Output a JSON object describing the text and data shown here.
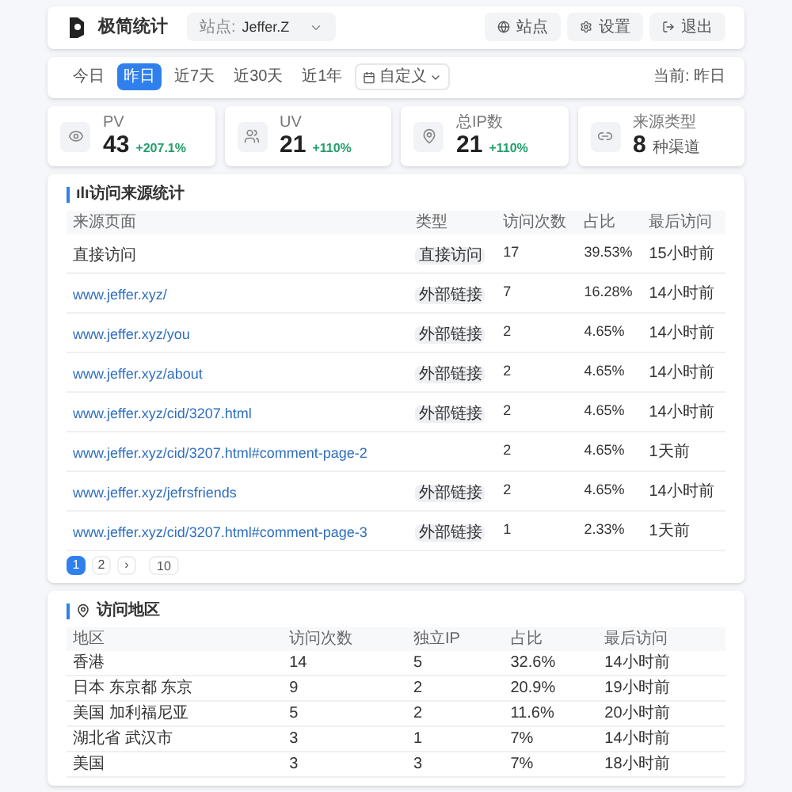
{
  "header": {
    "title": "极简统计",
    "site_label": "站点:",
    "site_value": "Jeffer.Z",
    "buttons": [
      {
        "kind": "site",
        "label": "站点"
      },
      {
        "kind": "settings",
        "label": "设置"
      },
      {
        "kind": "logout",
        "label": "退出"
      }
    ]
  },
  "filters": {
    "ranges": [
      {
        "label": "今日",
        "selected": false
      },
      {
        "label": "昨日",
        "selected": true
      },
      {
        "label": "近7天",
        "selected": false
      },
      {
        "label": "近30天",
        "selected": false
      },
      {
        "label": "近1年",
        "selected": false
      }
    ],
    "custom": "自定义",
    "current": "当前: 昨日"
  },
  "stats": [
    {
      "kind": "eye",
      "label": "PV",
      "value": "43",
      "change": "+207.1%"
    },
    {
      "kind": "users",
      "label": "UV",
      "value": "21",
      "change": "+110%"
    },
    {
      "kind": "pin",
      "label": "总IP数",
      "value": "21",
      "change": "+110%"
    },
    {
      "kind": "link",
      "label": "来源类型",
      "value": "8",
      "unit": "种渠道"
    }
  ],
  "sources": {
    "title": "访问来源统计",
    "title_icon": "ılı",
    "columns": [
      "来源页面",
      "类型",
      "访问次数",
      "占比",
      "最后访问"
    ],
    "rows": [
      {
        "page": "直接访问",
        "link": false,
        "type": "直接访问",
        "visits": "17",
        "share": "39.53%",
        "last": "15小时前"
      },
      {
        "page": "www.jeffer.xyz/",
        "link": true,
        "type": "外部链接",
        "visits": "7",
        "share": "16.28%",
        "last": "14小时前"
      },
      {
        "page": "www.jeffer.xyz/you",
        "link": true,
        "type": "外部链接",
        "visits": "2",
        "share": "4.65%",
        "last": "14小时前"
      },
      {
        "page": "www.jeffer.xyz/about",
        "link": true,
        "type": "外部链接",
        "visits": "2",
        "share": "4.65%",
        "last": "14小时前"
      },
      {
        "page": "www.jeffer.xyz/cid/3207.html",
        "link": true,
        "type": "外部链接",
        "visits": "2",
        "share": "4.65%",
        "last": "14小时前"
      },
      {
        "page": "www.jeffer.xyz/cid/3207.html#comment-page-2",
        "link": true,
        "visits": "2",
        "share": "4.65%",
        "last": "1天前"
      },
      {
        "page": "www.jeffer.xyz/jefrsfriends",
        "link": true,
        "type": "外部链接",
        "visits": "2",
        "share": "4.65%",
        "last": "14小时前"
      },
      {
        "page": "www.jeffer.xyz/cid/3207.html#comment-page-3",
        "link": true,
        "type": "外部链接",
        "visits": "1",
        "share": "2.33%",
        "last": "1天前"
      }
    ],
    "pages": [
      {
        "label": "1",
        "selected": true
      },
      {
        "label": "2",
        "selected": false
      },
      {
        "label": "›",
        "selected": false
      }
    ],
    "page_size": "10"
  },
  "regions": {
    "title": "访问地区",
    "columns": [
      "地区",
      "访问次数",
      "独立IP",
      "占比",
      "最后访问"
    ],
    "rows": [
      [
        "香港",
        "14",
        "5",
        "32.6%",
        "14小时前"
      ],
      [
        "日本 东京都 东京",
        "9",
        "2",
        "20.9%",
        "19小时前"
      ],
      [
        "美国 加利福尼亚",
        "5",
        "2",
        "11.6%",
        "20小时前"
      ],
      [
        "湖北省 武汉市",
        "3",
        "1",
        "7%",
        "14小时前"
      ],
      [
        "美国",
        "3",
        "3",
        "7%",
        "18小时前"
      ]
    ]
  }
}
